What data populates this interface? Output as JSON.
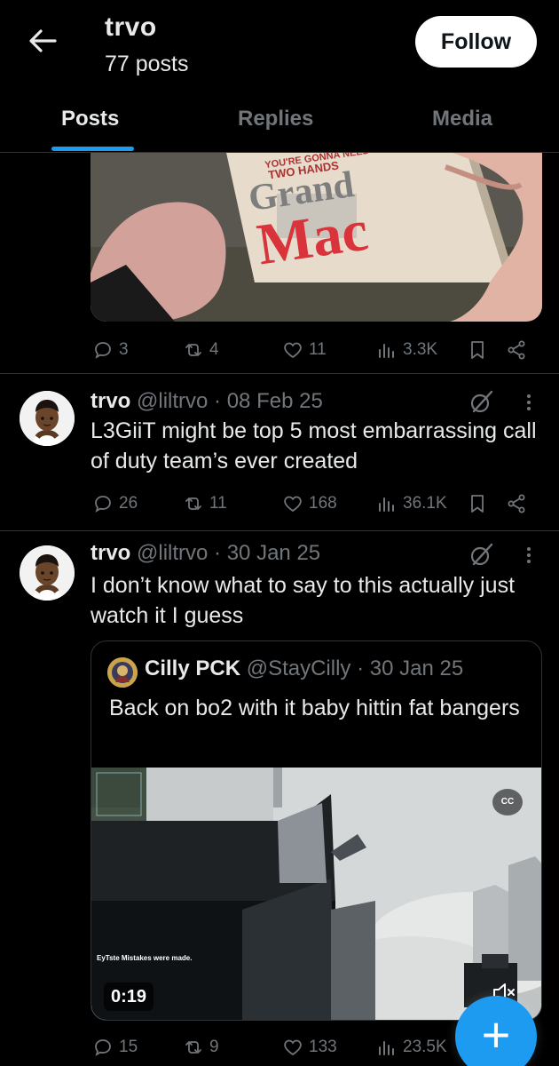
{
  "header": {
    "name": "trvo",
    "post_count": "77 posts",
    "follow_label": "Follow"
  },
  "tabs": [
    {
      "label": "Posts",
      "active": true
    },
    {
      "label": "Replies",
      "active": false
    },
    {
      "label": "Media",
      "active": false
    }
  ],
  "top_post": {
    "media_text": {
      "line1": "YOU'RE GONNA NEED",
      "line2": "TWO HANDS",
      "line3": "Grand",
      "line4": "Mac"
    },
    "stats": {
      "replies": "3",
      "reposts": "4",
      "likes": "11",
      "views": "3.3K"
    }
  },
  "post2": {
    "name": "trvo",
    "handle_date": "@liltrvo · 08 Feb 25",
    "text": "L3GiiT might be top 5 most embarrassing call of duty team’s ever created",
    "stats": {
      "replies": "26",
      "reposts": "11",
      "likes": "168",
      "views": "36.1K"
    }
  },
  "post3": {
    "name": "trvo",
    "handle_date": "@liltrvo · 30 Jan 25",
    "text": "I don’t know what to say to this actually just watch it I guess",
    "quote": {
      "name": "Cilly PCK",
      "handle_date": "@StayCilly · 30 Jan 25",
      "text": "Back on bo2 with it baby hittin fat bangers",
      "video_duration": "0:19",
      "cc_label": "CC",
      "overlay_text": "EyTste Mistakes were made."
    },
    "stats": {
      "replies": "15",
      "reposts": "9",
      "likes": "133",
      "views": "23.5K"
    }
  },
  "fab": {
    "label": "+"
  },
  "colors": {
    "background": "#000000",
    "accent": "#1d9bf0",
    "text": "#e7e9ea",
    "muted": "#71767b",
    "border": "#2f3336"
  }
}
